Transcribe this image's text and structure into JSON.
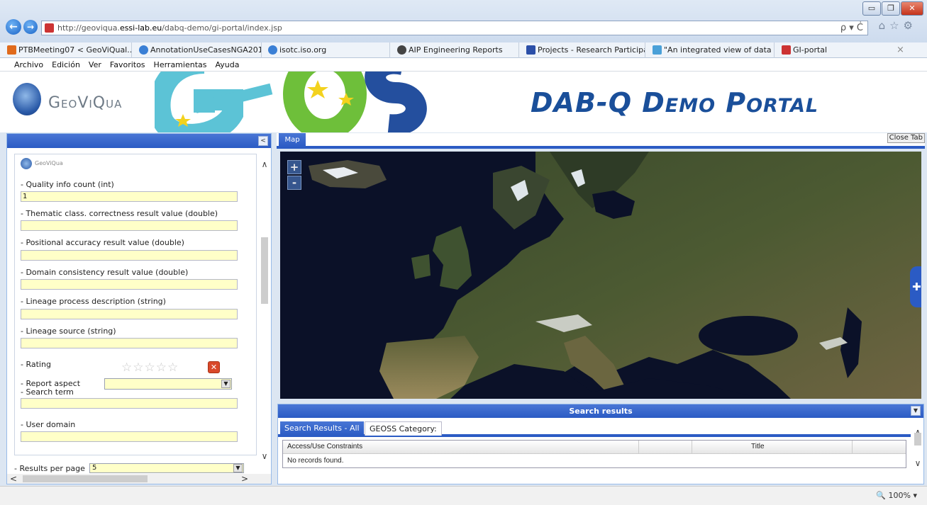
{
  "browser": {
    "url_prefix": "http://geoviqua.",
    "url_domain": "essi-lab.eu",
    "url_suffix": "/dabq-demo/gi-portal/index.jsp",
    "search_glyph": "ρ ▾ Ċ",
    "window_controls": {
      "minimize": "▭",
      "maximize": "❐",
      "close": "✕"
    },
    "toolbar_icons": [
      "home-icon",
      "favorites-star-icon",
      "gear-icon"
    ]
  },
  "favorites": [
    {
      "label": "PTBMeeting07 < GeoViQual...",
      "icon_color": "#e06a1b"
    },
    {
      "label": "AnnotationUseCasesNGA201...",
      "icon_color": "#3a7fd5"
    },
    {
      "label": "isotc.iso.org",
      "icon_color": "#3a7fd5"
    },
    {
      "label": "AIP Engineering Reports",
      "icon_color": "#444444"
    },
    {
      "label": "Projects - Research Participa...",
      "icon_color": "#2b4fa8"
    },
    {
      "label": "\"An integrated view of data ...",
      "icon_color": "#4aa0d8"
    },
    {
      "label": "GI-portal",
      "icon_color": "#c33333"
    }
  ],
  "favorites_close": "×",
  "menu": [
    "Archivo",
    "Edición",
    "Ver",
    "Favoritos",
    "Herramientas",
    "Ayuda"
  ],
  "banner": {
    "logo_text": "GeoViQua",
    "title": "DAB-Q Demo Portal"
  },
  "left_panel": {
    "collapse_glyph": "<",
    "logo_text": "GeoViQua",
    "fields": [
      {
        "label": "- Quality info count (int)",
        "value": "1"
      },
      {
        "label": "- Thematic class. correctness result value (double)",
        "value": ""
      },
      {
        "label": "- Positional accuracy result value (double)",
        "value": ""
      },
      {
        "label": "- Domain consistency result value (double)",
        "value": ""
      },
      {
        "label": "- Lineage process description (string)",
        "value": ""
      },
      {
        "label": "- Lineage source (string)",
        "value": ""
      }
    ],
    "rating_label": "- Rating",
    "rating_value": 0,
    "rating_max": 5,
    "report_aspect_label": "- Report aspect",
    "report_aspect_value": "",
    "search_term_label": "- Search term",
    "search_term_value": "",
    "user_domain_label": "- User domain",
    "user_domain_value": "",
    "results_per_page_label": "- Results per page",
    "results_per_page_value": "5"
  },
  "map_panel": {
    "tab": "Map",
    "close_tab": "Close Tab",
    "zoom_in": "+",
    "zoom_out": "-"
  },
  "results": {
    "title": "Search results",
    "tabs": [
      "Search Results - All",
      "GEOSS Category:"
    ],
    "columns": [
      "Access/Use Constraints",
      "",
      "",
      "Title",
      ""
    ],
    "empty_message": "No records found."
  },
  "status": {
    "zoom": "100%"
  }
}
